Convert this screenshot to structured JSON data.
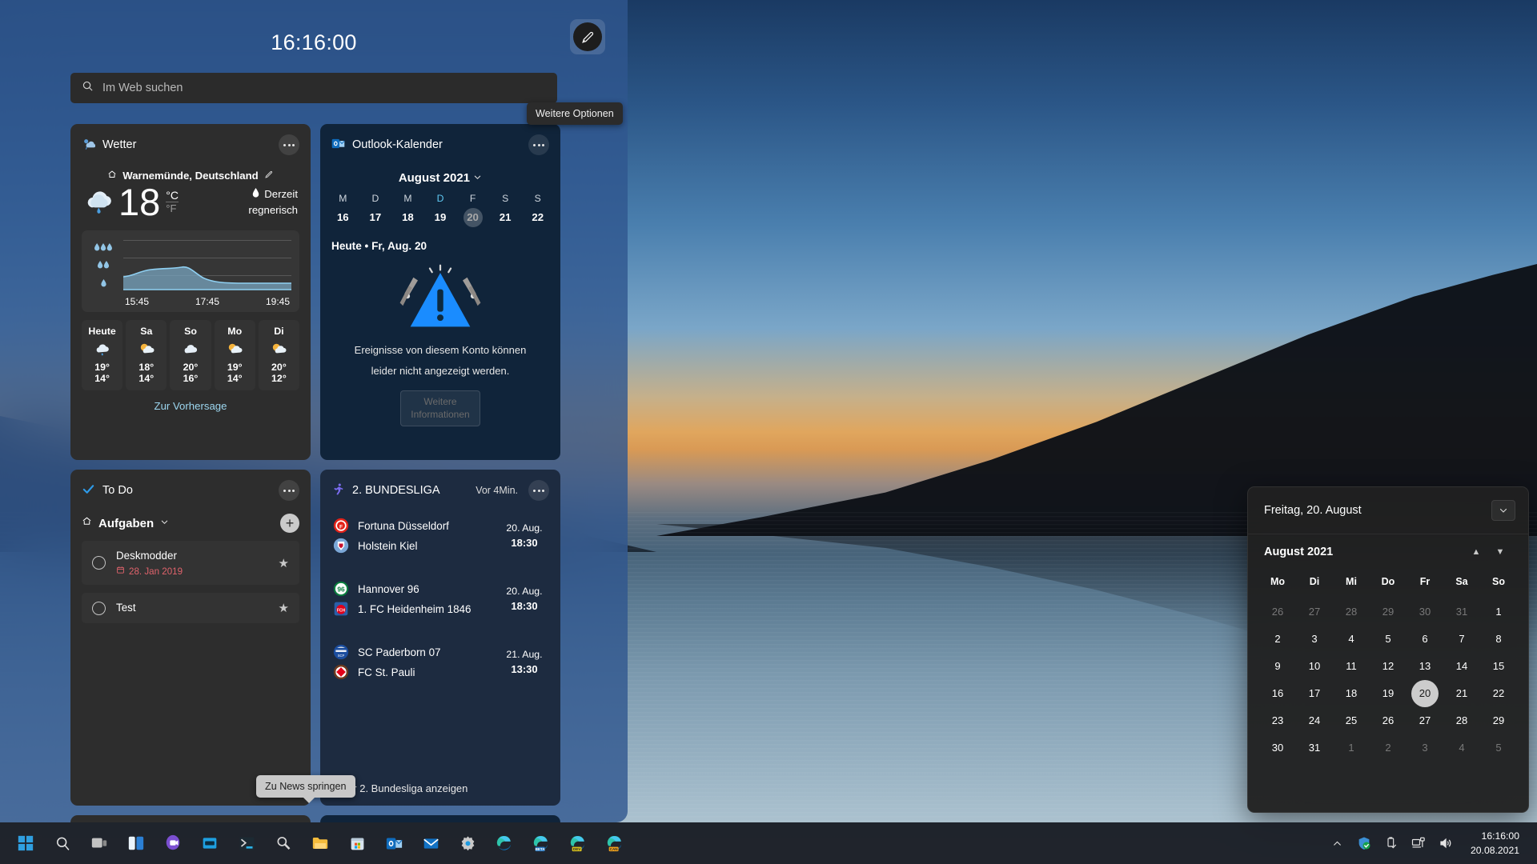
{
  "panel": {
    "clock": "16:16:00",
    "pen_icon": "pen-brush-icon",
    "search": {
      "placeholder": "Im Web suchen",
      "icon": "search-icon"
    }
  },
  "tooltips": {
    "more_options": "Weitere Optionen",
    "jump_to_news": "Zu News springen"
  },
  "weather": {
    "title": "Wetter",
    "icon": "partly-cloudy-rain-icon",
    "location": "Warnemünde, Deutschland",
    "home_icon": "home-icon",
    "edit_icon": "pencil-edit-icon",
    "temperature": "18",
    "unit_c": "°C",
    "unit_f": "°F",
    "condition_line1": "Derzeit",
    "condition_line2": "regnerisch",
    "condition_icon": "raindrop-icon",
    "current_icon": "rain-cloud-icon",
    "graph": {
      "times": [
        "15:45",
        "17:45",
        "19:45"
      ],
      "scale_labels": [
        "heavy-rain",
        "moderate-rain",
        "light-rain"
      ]
    },
    "forecast": [
      {
        "day": "Heute",
        "icon": "rain-cloud-icon",
        "high": "19°",
        "low": "14°"
      },
      {
        "day": "Sa",
        "icon": "sun-cloud-icon",
        "high": "18°",
        "low": "14°"
      },
      {
        "day": "So",
        "icon": "cloud-icon",
        "high": "20°",
        "low": "16°"
      },
      {
        "day": "Mo",
        "icon": "sun-cloud-icon",
        "high": "19°",
        "low": "14°"
      },
      {
        "day": "Di",
        "icon": "sun-cloud-icon",
        "high": "20°",
        "low": "12°"
      }
    ],
    "forecast_link": "Zur Vorhersage"
  },
  "outlook": {
    "title": "Outlook-Kalender",
    "icon": "outlook-icon",
    "month": "August 2021",
    "chevron_icon": "chevron-down-icon",
    "dow": [
      "M",
      "D",
      "M",
      "D",
      "F",
      "S",
      "S"
    ],
    "days": [
      "16",
      "17",
      "18",
      "19",
      "20",
      "21",
      "22"
    ],
    "today_index": 4,
    "today_line": "Heute • Fr, Aug. 20",
    "error_icon": "warning-triangle-icon",
    "error_line1": "Ereignisse von diesem Konto können",
    "error_line2": "leider nicht angezeigt werden.",
    "error_button": "Weitere Informationen"
  },
  "todo": {
    "title": "To Do",
    "icon": "checkmark-icon",
    "list_name": "Aufgaben",
    "list_icon": "home-icon",
    "chevron_icon": "chevron-down-icon",
    "add_icon": "plus-icon",
    "items": [
      {
        "text": "Deskmodder",
        "due": "28. Jan 2019",
        "due_icon": "calendar-icon",
        "star_icon": "star-icon",
        "check_icon": "circle-unchecked-icon"
      },
      {
        "text": "Test",
        "due": "",
        "due_icon": "",
        "star_icon": "star-icon",
        "check_icon": "circle-unchecked-icon"
      }
    ]
  },
  "sports": {
    "title": "2. BUNDESLIGA",
    "icon": "running-person-icon",
    "updated": "Vor 4Min.",
    "matches": [
      {
        "home": "Fortuna Düsseldorf",
        "home_crest": "fortuna-duesseldorf-crest",
        "away": "Holstein Kiel",
        "away_crest": "holstein-kiel-crest",
        "date": "20. Aug.",
        "time": "18:30"
      },
      {
        "home": "Hannover 96",
        "home_crest": "hannover-96-crest",
        "away": "1. FC Heidenheim 1846",
        "away_crest": "heidenheim-crest",
        "date": "20. Aug.",
        "time": "18:30"
      },
      {
        "home": "SC Paderborn 07",
        "home_crest": "paderborn-crest",
        "away": "FC St. Pauli",
        "away_crest": "st-pauli-crest",
        "date": "21. Aug.",
        "time": "13:30"
      }
    ],
    "more_link": "Mehr 2. Bundesliga anzeigen"
  },
  "cal_flyout": {
    "date_label": "Freitag, 20. August",
    "collapse_icon": "chevron-down-icon",
    "month": "August 2021",
    "up_icon": "triangle-up-icon",
    "down_icon": "triangle-down-icon",
    "dow": [
      "Mo",
      "Di",
      "Mi",
      "Do",
      "Fr",
      "Sa",
      "So"
    ],
    "weeks": [
      [
        {
          "d": "26",
          "o": true
        },
        {
          "d": "27",
          "o": true
        },
        {
          "d": "28",
          "o": true
        },
        {
          "d": "29",
          "o": true
        },
        {
          "d": "30",
          "o": true
        },
        {
          "d": "31",
          "o": true
        },
        {
          "d": "1",
          "o": false
        }
      ],
      [
        {
          "d": "2",
          "o": false
        },
        {
          "d": "3",
          "o": false
        },
        {
          "d": "4",
          "o": false
        },
        {
          "d": "5",
          "o": false
        },
        {
          "d": "6",
          "o": false
        },
        {
          "d": "7",
          "o": false
        },
        {
          "d": "8",
          "o": false
        }
      ],
      [
        {
          "d": "9",
          "o": false
        },
        {
          "d": "10",
          "o": false
        },
        {
          "d": "11",
          "o": false
        },
        {
          "d": "12",
          "o": false
        },
        {
          "d": "13",
          "o": false
        },
        {
          "d": "14",
          "o": false
        },
        {
          "d": "15",
          "o": false
        }
      ],
      [
        {
          "d": "16",
          "o": false
        },
        {
          "d": "17",
          "o": false
        },
        {
          "d": "18",
          "o": false
        },
        {
          "d": "19",
          "o": false
        },
        {
          "d": "20",
          "o": false,
          "sel": true
        },
        {
          "d": "21",
          "o": false
        },
        {
          "d": "22",
          "o": false
        }
      ],
      [
        {
          "d": "23",
          "o": false
        },
        {
          "d": "24",
          "o": false
        },
        {
          "d": "25",
          "o": false
        },
        {
          "d": "26",
          "o": false
        },
        {
          "d": "27",
          "o": false
        },
        {
          "d": "28",
          "o": false
        },
        {
          "d": "29",
          "o": false
        }
      ],
      [
        {
          "d": "30",
          "o": false
        },
        {
          "d": "31",
          "o": false
        },
        {
          "d": "1",
          "o": true
        },
        {
          "d": "2",
          "o": true
        },
        {
          "d": "3",
          "o": true
        },
        {
          "d": "4",
          "o": true
        },
        {
          "d": "5",
          "o": true
        }
      ]
    ]
  },
  "taskbar": {
    "icons": [
      "start-icon",
      "search-icon",
      "task-view-icon",
      "widgets-icon",
      "teams-chat-icon",
      "app-window-icon",
      "terminal-icon",
      "magnifier-icon",
      "file-explorer-icon",
      "microsoft-store-icon",
      "outlook-icon",
      "mail-icon",
      "settings-gear-icon",
      "edge-icon",
      "edge-beta-icon",
      "edge-dev-icon",
      "edge-canary-icon"
    ],
    "tray": [
      "chevron-up-icon",
      "defender-shield-icon",
      "usb-eject-icon",
      "network-icon",
      "volume-icon"
    ],
    "clock_time": "16:16:00",
    "clock_date": "20.08.2021"
  },
  "colors": {
    "panel_bg": "#30568e",
    "card_bg": "#2d2d2d",
    "accent_link": "#9cd6ef",
    "due_red": "#e0636c",
    "graph_line": "#6fb6dd"
  }
}
